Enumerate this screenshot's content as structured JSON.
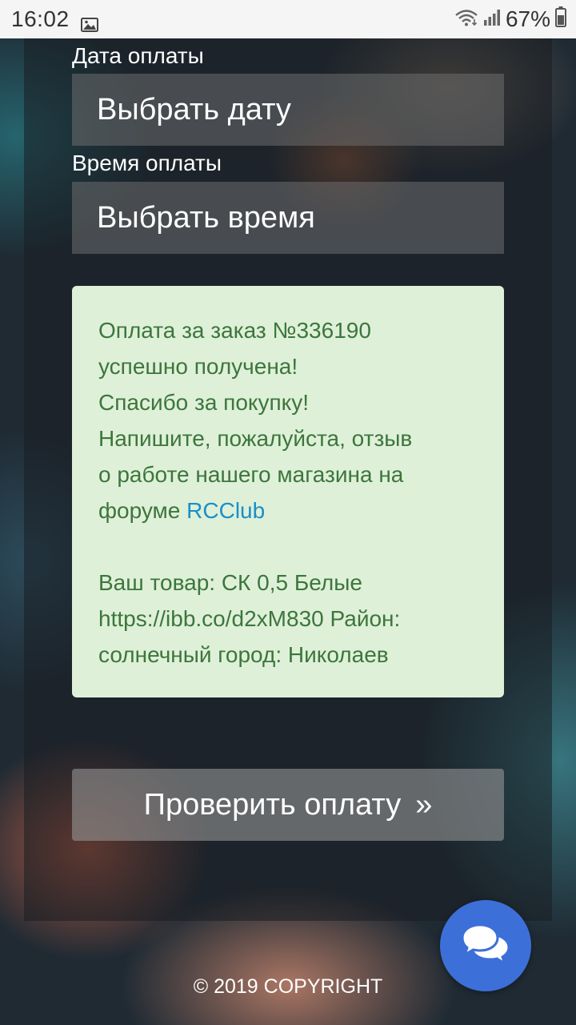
{
  "status_bar": {
    "time": "16:02",
    "battery": "67%",
    "icons": [
      "image-icon",
      "wifi-icon",
      "signal-icon",
      "battery-icon"
    ]
  },
  "payment_date": {
    "label": "Дата оплаты",
    "value": "Выбрать дату"
  },
  "payment_time": {
    "label": "Время оплаты",
    "value": "Выбрать время"
  },
  "success_message": {
    "lines": [
      "Оплата за заказ №336190",
      "успешно получена!",
      "Спасибо за покупку!",
      "Напишите, пожалуйста, отзыв",
      "о работе нашего магазина на"
    ],
    "forum_prefix": "форуме ",
    "forum_link": "RCClub",
    "product_lines": [
      "Ваш товар: СК 0,5 Белые",
      "https://ibb.co/d2xM830 Район:",
      "солнечный город: Николаев"
    ]
  },
  "check_button": {
    "label": "Проверить оплату",
    "chevron": "»"
  },
  "footer": {
    "copyright": "© 2019 COPYRIGHT"
  },
  "chat": {
    "icon": "chat-bubbles-icon"
  },
  "colors": {
    "success_bg": "#dff0d8",
    "success_text": "#3c763d",
    "link": "#1a8fc9",
    "chat_button": "#3d6fd8"
  }
}
